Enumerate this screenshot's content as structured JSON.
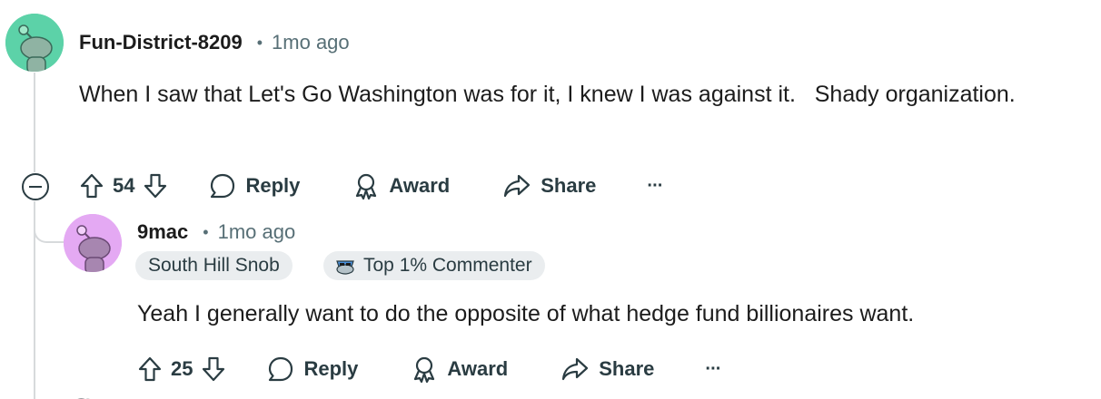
{
  "comments": [
    {
      "username": "Fun-District-8209",
      "separator": "•",
      "time": "1mo ago",
      "body": "When I saw that Let's Go Washington was for it, I knew I was against it.   Shady organization.",
      "score": "54",
      "reply_label": "Reply",
      "award_label": "Award",
      "share_label": "Share",
      "more_label": "···",
      "avatar_bg": "#54d0a4"
    },
    {
      "username": "9mac",
      "separator": "•",
      "time": "1mo ago",
      "flair": "South Hill Snob",
      "badge": "Top 1% Commenter",
      "body": "Yeah I generally want to do the opposite of what hedge fund billionaires want.",
      "score": "25",
      "reply_label": "Reply",
      "award_label": "Award",
      "share_label": "Share",
      "more_label": "···",
      "avatar_bg": "#e3a6f2"
    }
  ],
  "icons": {
    "collapse": "minus-circle-icon",
    "upvote": "arrow-up-icon",
    "downvote": "arrow-down-icon",
    "reply": "speech-bubble-icon",
    "award": "award-ribbon-icon",
    "share": "share-arrow-icon",
    "more": "ellipsis-icon"
  }
}
